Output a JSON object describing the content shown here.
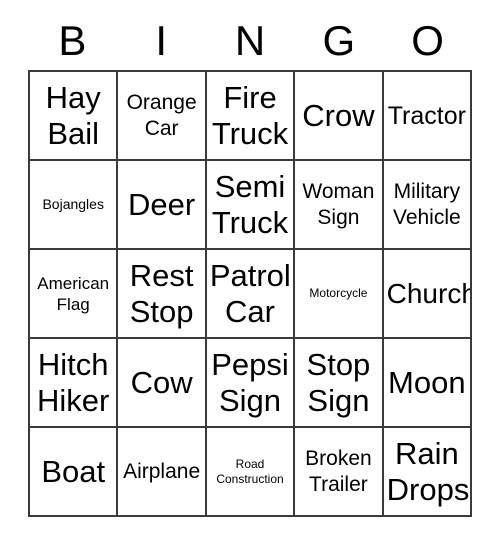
{
  "card": {
    "headers": [
      "B",
      "I",
      "N",
      "G",
      "O"
    ],
    "rows": [
      [
        {
          "label": "Hay\nBail",
          "size": "xxl"
        },
        {
          "label": "Orange\nCar",
          "size": "md"
        },
        {
          "label": "Fire\nTruck",
          "size": "xxl"
        },
        {
          "label": "Crow",
          "size": "xxl"
        },
        {
          "label": "Tractor",
          "size": "lg"
        }
      ],
      [
        {
          "label": "Bojangles",
          "size": "xs"
        },
        {
          "label": "Deer",
          "size": "xxl"
        },
        {
          "label": "Semi\nTruck",
          "size": "xxl"
        },
        {
          "label": "Woman\nSign",
          "size": "md"
        },
        {
          "label": "Military\nVehicle",
          "size": "md"
        }
      ],
      [
        {
          "label": "American\nFlag",
          "size": "sm"
        },
        {
          "label": "Rest\nStop",
          "size": "xxl"
        },
        {
          "label": "Patrol\nCar",
          "size": "xxl"
        },
        {
          "label": "Motorcycle",
          "size": "xxs"
        },
        {
          "label": "Church",
          "size": "xl"
        }
      ],
      [
        {
          "label": "Hitch\nHiker",
          "size": "xxl"
        },
        {
          "label": "Cow",
          "size": "xxl"
        },
        {
          "label": "Pepsi\nSign",
          "size": "xxl"
        },
        {
          "label": "Stop\nSign",
          "size": "xxl"
        },
        {
          "label": "Moon",
          "size": "xxl"
        }
      ],
      [
        {
          "label": "Boat",
          "size": "xxl"
        },
        {
          "label": "Airplane",
          "size": "md"
        },
        {
          "label": "Road\nConstruction",
          "size": "xxs"
        },
        {
          "label": "Broken\nTrailer",
          "size": "md"
        },
        {
          "label": "Rain\nDrops",
          "size": "xxl"
        }
      ]
    ]
  },
  "colors": {
    "background": "#ffffff",
    "text": "#000000",
    "grid_line": "#3a3a3a"
  }
}
